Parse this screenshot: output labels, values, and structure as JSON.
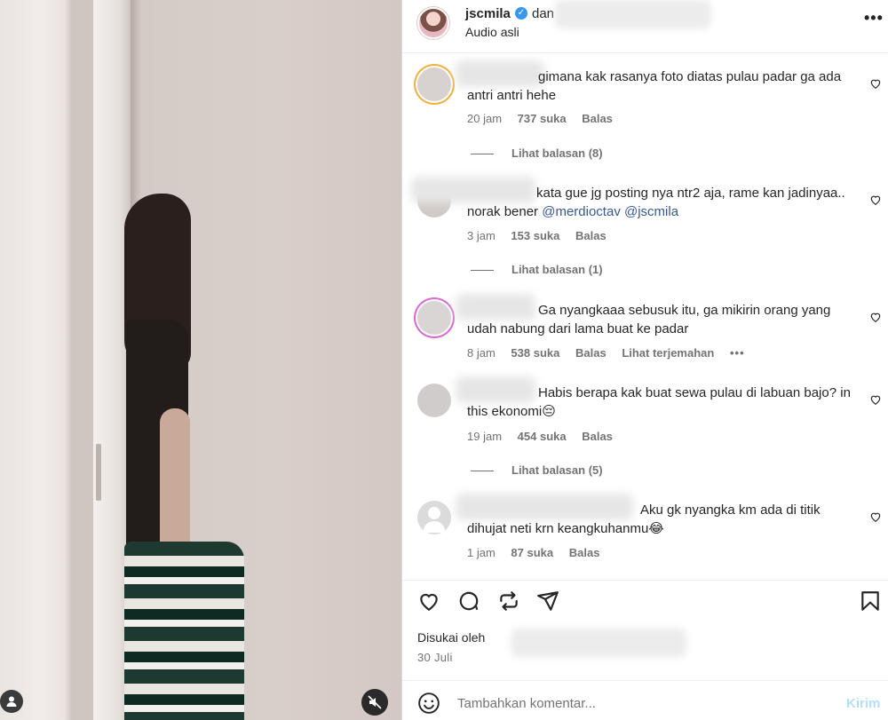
{
  "header": {
    "username": "jscmila",
    "and": "dan",
    "audio": "Audio asli",
    "more": "•••"
  },
  "comments": [
    {
      "text": "gimana kak rasanya foto diatas pulau padar ga ada antri antri hehe",
      "time": "20 jam",
      "likes": "737 suka",
      "reply": "Balas",
      "view_replies": "Lihat balasan (8)"
    },
    {
      "text": "kata gue jg posting nya ntr2 aja, rame kan jadinyaa.. norak bener",
      "mention1": "@merdioctav",
      "mention2": "@jscmila",
      "time": "3 jam",
      "likes": "153 suka",
      "reply": "Balas",
      "view_replies": "Lihat balasan (1)"
    },
    {
      "text": "Ga nyangkaaa sebusuk itu, ga mikirin orang yang udah nabung dari lama buat ke padar",
      "time": "8 jam",
      "likes": "538 suka",
      "reply": "Balas",
      "translate": "Lihat terjemahan",
      "more": "•••"
    },
    {
      "text": "Habis berapa kak buat sewa pulau di labuan bajo? in this ekonomi😔",
      "time": "19 jam",
      "likes": "454 suka",
      "reply": "Balas",
      "view_replies": "Lihat balasan (5)"
    },
    {
      "text": "Aku gk nyangka km ada di titik dihujat neti krn keangkuhanmu😂",
      "time": "1 jam",
      "likes": "87 suka",
      "reply": "Balas"
    }
  ],
  "liked_by": "Disukai oleh",
  "date": "30 Juli",
  "comment_box": {
    "placeholder": "Tambahkan komentar...",
    "send": "Kirim"
  },
  "icons": {
    "like": "heart-icon",
    "comment": "comment-icon",
    "repost": "repost-icon",
    "share": "share-icon",
    "save": "bookmark-icon",
    "emoji": "emoji-icon",
    "mute": "muted-speaker-icon",
    "tagged": "person-icon"
  },
  "colors": {
    "link": "#385898",
    "muted": "#737373",
    "send_disabled": "#b2dffc",
    "verified": "#3897f0"
  }
}
